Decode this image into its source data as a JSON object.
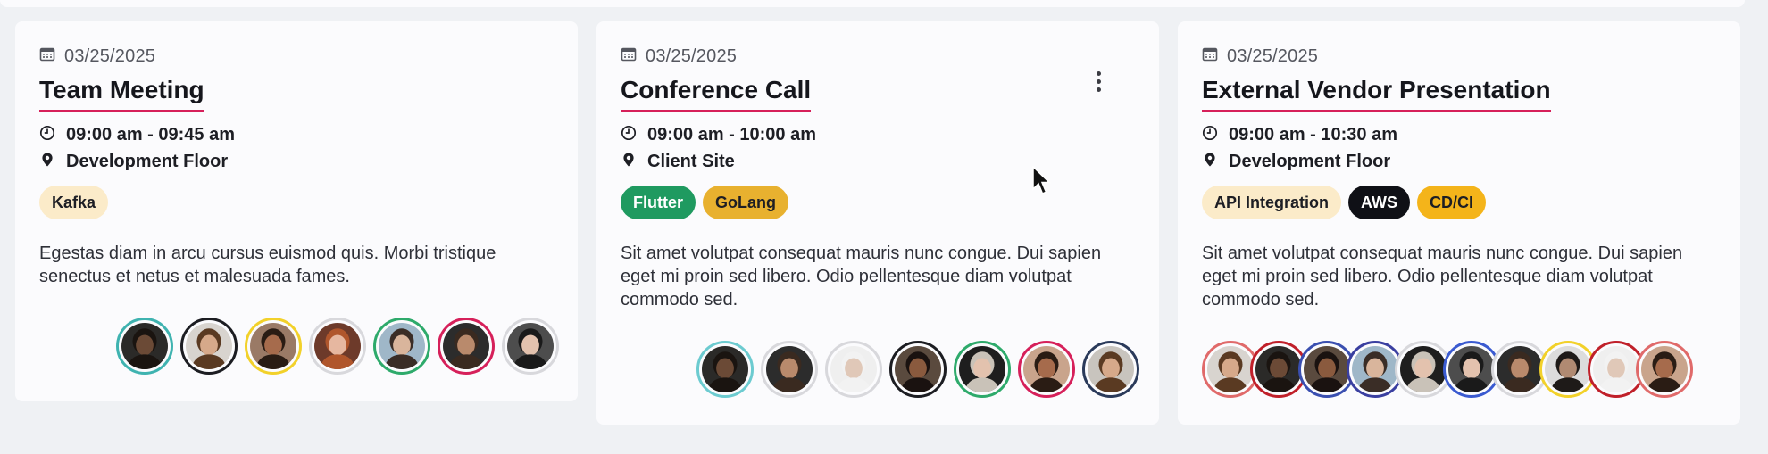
{
  "cards": [
    {
      "date": "03/25/2025",
      "title": "Team Meeting",
      "time": "09:00 am - 09:45 am",
      "location": "Development Floor",
      "tags": [
        {
          "label": "Kafka",
          "bg": "#fbebc9",
          "fg": "#1d1e24"
        }
      ],
      "description": "Egestas diam in arcu cursus euismod quis. Morbi tristique senectus et netus et malesuada fames.",
      "attendees": [
        {
          "ring": "#3fb3b0",
          "skin": "#6b4a36",
          "hair": "#1a1410",
          "bg": "#2b2a28"
        },
        {
          "ring": "#1c1d22",
          "skin": "#d6a98a",
          "hair": "#5a3a22",
          "bg": "#d8d4cf"
        },
        {
          "ring": "#f2d12a",
          "skin": "#a66b4c",
          "hair": "#2a1c14",
          "bg": "#9a7a66"
        },
        {
          "ring": "#d8d8dc",
          "skin": "#e6b7a0",
          "hair": "#b0562c",
          "bg": "#6d3a2a"
        },
        {
          "ring": "#2eaa6b",
          "skin": "#d9b59c",
          "hair": "#3a2d26",
          "bg": "#9fb7c8"
        },
        {
          "ring": "#d6205a",
          "skin": "#b98a6c",
          "hair": "#3a2a20",
          "bg": "#2c2c2c"
        },
        {
          "ring": "#d8d8dc",
          "skin": "#e3c2ae",
          "hair": "#1a1a1a",
          "bg": "#4d4d4d"
        }
      ]
    },
    {
      "date": "03/25/2025",
      "title": "Conference Call",
      "time": "09:00 am - 10:00 am",
      "location": "Client Site",
      "tags": [
        {
          "label": "Flutter",
          "bg": "#1f9a60",
          "fg": "#ffffff"
        },
        {
          "label": "GoLang",
          "bg": "#e8b12f",
          "fg": "#1d1e24"
        }
      ],
      "description": "Sit amet volutpat consequat mauris nunc congue. Dui sapien eget mi proin sed libero. Odio pellentesque diam volutpat commodo sed.",
      "attendees": [
        {
          "ring": "#6ccbd0",
          "skin": "#6b4a36",
          "hair": "#1a1410",
          "bg": "#2b2a28"
        },
        {
          "ring": "#d8d8dc",
          "skin": "#b98a6c",
          "hair": "#3a2a20",
          "bg": "#2c2c2c"
        },
        {
          "ring": "#d8d8dc",
          "skin": "#e0c8b8",
          "hair": "#f2f2f2",
          "bg": "#efefef"
        },
        {
          "ring": "#1c1d22",
          "skin": "#8a5a3e",
          "hair": "#1a1210",
          "bg": "#5a4a3e"
        },
        {
          "ring": "#2eaa6b",
          "skin": "#e3c2ae",
          "hair": "#c9c2b8",
          "bg": "#1e1e1e"
        },
        {
          "ring": "#d6205a",
          "skin": "#a66b4c",
          "hair": "#2a1c14",
          "bg": "#c9a48c"
        },
        {
          "ring": "#2a3a5a",
          "skin": "#d6a98a",
          "hair": "#5a3a22",
          "bg": "#c8c4be"
        }
      ]
    },
    {
      "date": "03/25/2025",
      "title": "External Vendor Presentation",
      "time": "09:00 am - 10:30 am",
      "location": "Development Floor",
      "tags": [
        {
          "label": "API Integration",
          "bg": "#fbebc9",
          "fg": "#1d1e24"
        },
        {
          "label": "AWS",
          "bg": "#0f1016",
          "fg": "#ffffff"
        },
        {
          "label": "CD/CI",
          "bg": "#f4b41a",
          "fg": "#1d1e24"
        }
      ],
      "description": "Sit amet volutpat consequat mauris nunc congue. Dui sapien eget mi proin sed libero. Odio pellentesque diam volutpat commodo sed.",
      "attendees": [
        {
          "ring": "#e06a6a",
          "skin": "#d6a98a",
          "hair": "#5a3a22",
          "bg": "#d8d4cf"
        },
        {
          "ring": "#c0202a",
          "skin": "#6b4a36",
          "hair": "#1a1410",
          "bg": "#2b2a28"
        },
        {
          "ring": "#3a4fb0",
          "skin": "#8a5a3e",
          "hair": "#1a1210",
          "bg": "#5a4a3e"
        },
        {
          "ring": "#3a3fa0",
          "skin": "#d9b59c",
          "hair": "#3a2d26",
          "bg": "#9fb7c8"
        },
        {
          "ring": "#d8d8dc",
          "skin": "#e3c2ae",
          "hair": "#c9c2b8",
          "bg": "#1e1e1e"
        },
        {
          "ring": "#3a5ad0",
          "skin": "#e3c2ae",
          "hair": "#1a1a1a",
          "bg": "#4d4d4d"
        },
        {
          "ring": "#d8d8dc",
          "skin": "#b98a6c",
          "hair": "#3a2a20",
          "bg": "#2c2c2c"
        },
        {
          "ring": "#f2d12a",
          "skin": "#b08a72",
          "hair": "#1e1a18",
          "bg": "#dcdcdc"
        },
        {
          "ring": "#c0202a",
          "skin": "#e0c8b8",
          "hair": "#f2f2f2",
          "bg": "#efefef"
        },
        {
          "ring": "#e06a6a",
          "skin": "#a66b4c",
          "hair": "#2a1c14",
          "bg": "#c9a48c"
        }
      ]
    }
  ]
}
